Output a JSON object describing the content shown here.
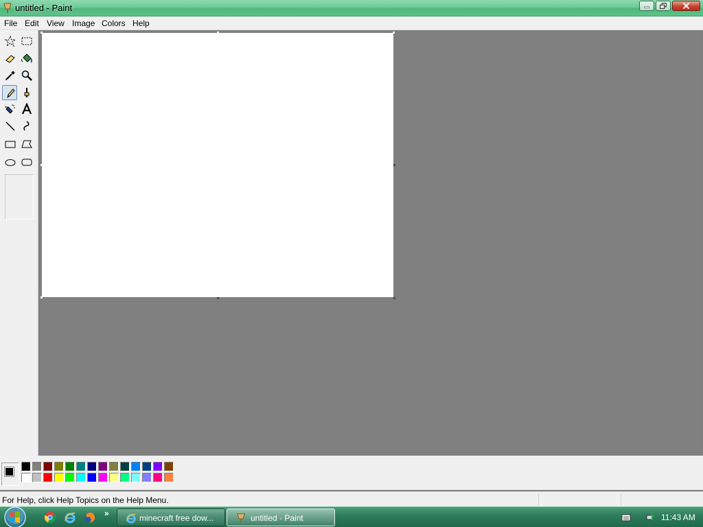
{
  "window": {
    "title": "untitled - Paint"
  },
  "menu": [
    "File",
    "Edit",
    "View",
    "Image",
    "Colors",
    "Help"
  ],
  "tools": [
    {
      "name": "free-form-select",
      "icon": "star-select-icon"
    },
    {
      "name": "select",
      "icon": "rect-select-icon"
    },
    {
      "name": "eraser",
      "icon": "eraser-icon"
    },
    {
      "name": "fill-with-color",
      "icon": "paint-bucket-icon"
    },
    {
      "name": "pick-color",
      "icon": "eyedropper-icon"
    },
    {
      "name": "magnifier",
      "icon": "magnifier-icon"
    },
    {
      "name": "pencil",
      "icon": "pencil-icon",
      "selected": true
    },
    {
      "name": "brush",
      "icon": "brush-icon"
    },
    {
      "name": "airbrush",
      "icon": "airbrush-icon"
    },
    {
      "name": "text",
      "icon": "text-icon",
      "label": "A"
    },
    {
      "name": "line",
      "icon": "line-icon"
    },
    {
      "name": "curve",
      "icon": "curve-icon"
    },
    {
      "name": "rectangle",
      "icon": "rectangle-icon"
    },
    {
      "name": "polygon",
      "icon": "polygon-icon"
    },
    {
      "name": "ellipse",
      "icon": "ellipse-icon"
    },
    {
      "name": "rounded-rectangle",
      "icon": "rounded-rectangle-icon"
    }
  ],
  "palette": {
    "foreground": "#000000",
    "background": "#ffffff",
    "colors_top": [
      "#000000",
      "#808080",
      "#800000",
      "#808000",
      "#008000",
      "#008080",
      "#000080",
      "#800080",
      "#808040",
      "#004040",
      "#0080ff",
      "#004080",
      "#8000ff",
      "#804000"
    ],
    "colors_bottom": [
      "#ffffff",
      "#c0c0c0",
      "#ff0000",
      "#ffff00",
      "#00ff00",
      "#00ffff",
      "#0000ff",
      "#ff00ff",
      "#ffff80",
      "#00ff80",
      "#80ffff",
      "#8080ff",
      "#ff0080",
      "#ff8040"
    ]
  },
  "status": {
    "help_text": "For Help, click Help Topics on the Help Menu."
  },
  "taskbar": {
    "tasks": [
      {
        "label": "minecraft free dow...",
        "icon": "internet-explorer-icon"
      },
      {
        "label": "untitled - Paint",
        "icon": "paint-icon",
        "active": true
      }
    ],
    "clock": "11:43 AM"
  }
}
